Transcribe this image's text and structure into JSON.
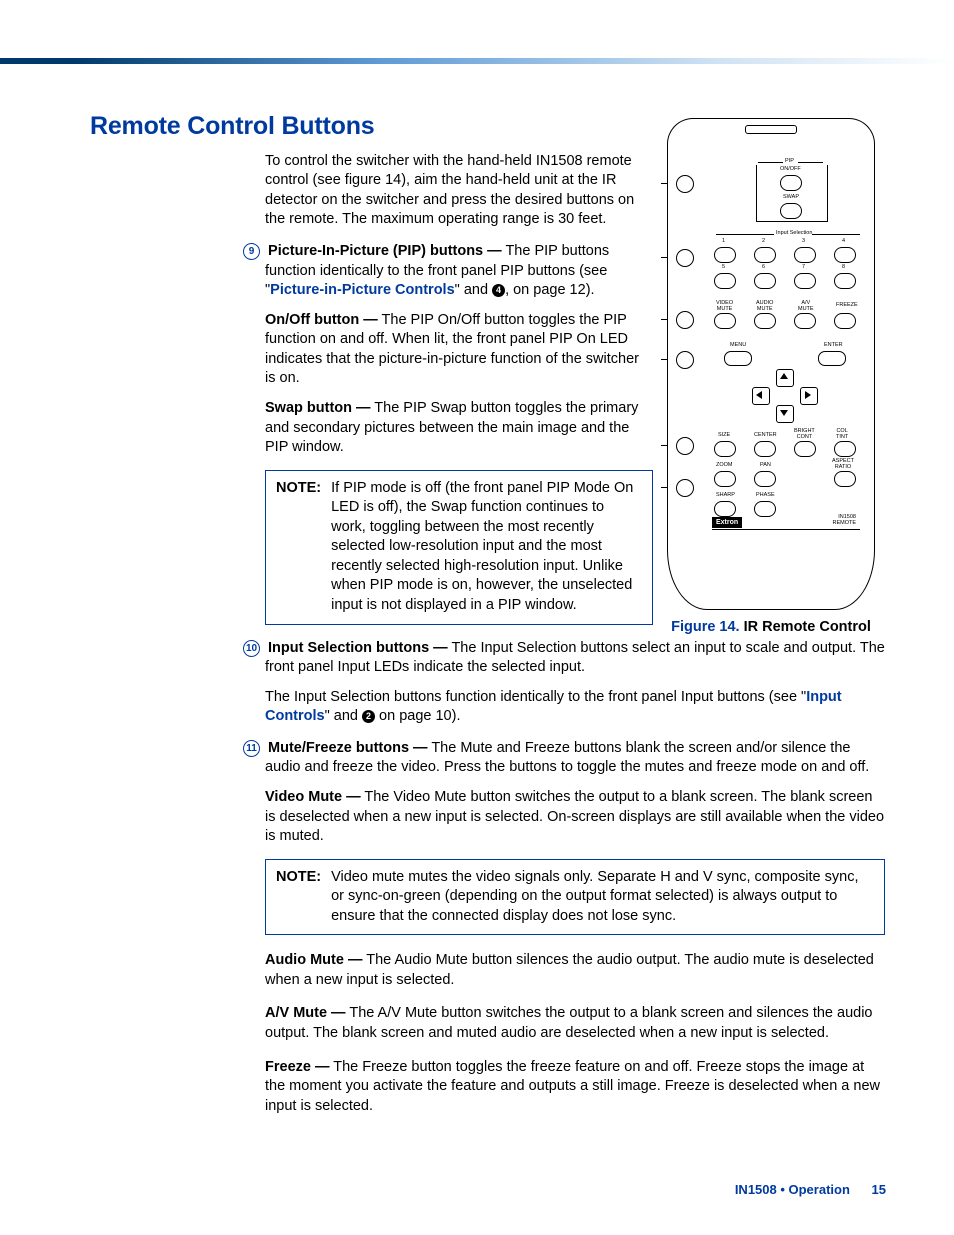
{
  "heading": "Remote Control Buttons",
  "intro": "To control the switcher with the hand-held IN1508 remote control (see figure 14), aim the hand-held unit at the IR detector on the switcher and press the desired buttons on the remote. The maximum operating range is 30 feet.",
  "callouts": {
    "c9": {
      "num": "9",
      "title": "Picture-In-Picture (PIP) buttons —",
      "text_before_link": "The PIP buttons function identically to the front panel PIP buttons (see \"",
      "link": "Picture-in-Picture Controls",
      "text_after_link": "\" and ",
      "ref": "4",
      "tail": ", on page 12)."
    },
    "onoff": {
      "title": "On/Off button —",
      "text": "The PIP On/Off button toggles the PIP function on and off. When lit, the front panel PIP On LED indicates that the picture-in-picture function of the switcher is on."
    },
    "swap": {
      "title": "Swap button —",
      "text": "The PIP Swap button toggles the primary and secondary pictures between the main image and the PIP window."
    },
    "note1": {
      "label": "NOTE:",
      "text": "If PIP mode is off (the front panel PIP Mode On LED is off), the Swap function continues to work, toggling between the most recently selected low-resolution input and the most recently selected high-resolution input. Unlike when PIP mode is on, however, the unselected input is not displayed in a PIP window."
    },
    "c10": {
      "num": "10",
      "title": "Input Selection buttons —",
      "text": "The Input Selection buttons select an input to scale and output. The front panel Input LEDs indicate the selected input.",
      "para2_pre": "The Input Selection buttons function identically to the front panel Input buttons (see \"",
      "link": "Input Controls",
      "para2_mid": "\" and ",
      "ref": "2",
      "para2_tail": " on page 10)."
    },
    "c11": {
      "num": "11",
      "title": "Mute/Freeze buttons —",
      "text": "The Mute and Freeze buttons blank the screen and/or silence the audio and freeze the video. Press the buttons to toggle the mutes and freeze mode on and off."
    },
    "vmute": {
      "title": "Video Mute —",
      "text": "The Video Mute button switches the output to a blank screen. The blank screen is deselected when a new input is selected. On-screen displays are still available when the video is muted."
    },
    "note2": {
      "label": "NOTE:",
      "text": "Video mute mutes the video signals only. Separate H and V sync, composite sync, or sync-on-green (depending on the output format selected) is always output to ensure that the connected display does not lose sync."
    },
    "amute": {
      "title": "Audio Mute —",
      "text": "The Audio Mute button silences the audio output. The audio mute is deselected when a new input is selected."
    },
    "avmute": {
      "title": "A/V Mute —",
      "text": "The A/V Mute button switches the output to a blank screen and silences the audio output. The blank screen and muted audio are deselected when a new input is selected."
    },
    "freeze": {
      "title": "Freeze —",
      "text": "The Freeze button toggles the freeze feature on and off. Freeze stops the image at the moment you activate the feature and outputs a still image. Freeze is deselected when a new input is selected."
    }
  },
  "figure": {
    "label": "Figure 14.",
    "caption": " IR Remote Control"
  },
  "remote_labels": {
    "pip": "PIP",
    "onoff": "ON/OFF",
    "swap": "SWAP",
    "input_sel": "Input Selection",
    "n1": "1",
    "n2": "2",
    "n3": "3",
    "n4": "4",
    "n5": "5",
    "n6": "6",
    "n7": "7",
    "n8": "8",
    "vmute": "VIDEO\nMUTE",
    "amute": "AUDIO\nMUTE",
    "avmute": "A/V\nMUTE",
    "freeze": "FREEZE",
    "menu": "MENU",
    "enter": "ENTER",
    "size": "SIZE",
    "center": "CENTER",
    "bright": "BRIGHT\nCONT",
    "color": "COL\nTINT",
    "zoom": "ZOOM",
    "pan": "PAN",
    "aspect": "ASPECT\nRATIO",
    "sharp": "SHARP",
    "phase": "PHASE",
    "brand": "Extron",
    "model": "IN1508\nREMOTE"
  },
  "footer": {
    "section": "IN1508 • Operation",
    "page": "15"
  }
}
